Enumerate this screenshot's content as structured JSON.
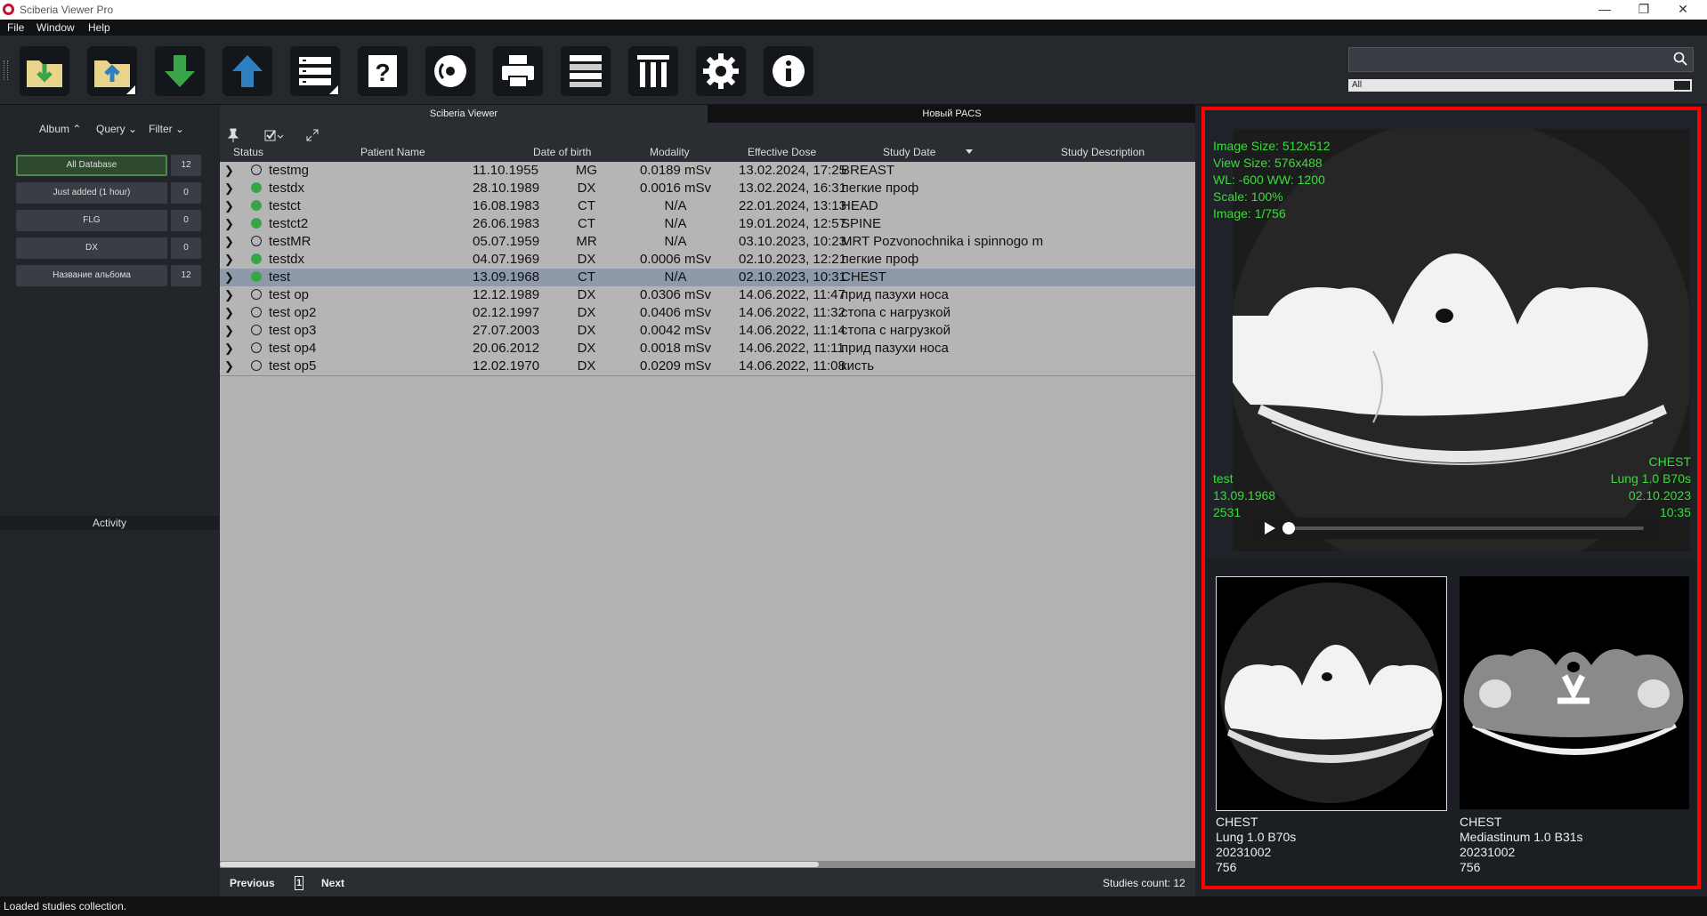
{
  "app": {
    "title": "Sciberia Viewer Pro"
  },
  "window_controls": {
    "minimize": "—",
    "maximize": "❐",
    "close": "✕"
  },
  "menu": [
    "File",
    "Window",
    "Help"
  ],
  "toolbar": {
    "buttons": [
      "import-folder",
      "upload-folder",
      "download",
      "upload",
      "server-list",
      "help",
      "burn-disc",
      "print",
      "layout",
      "delete",
      "settings",
      "info"
    ]
  },
  "search": {
    "placeholder": "",
    "filter_value": "All"
  },
  "left": {
    "album": "Album ⌃",
    "query": "Query ⌄",
    "filter": "Filter ⌄",
    "albums": [
      {
        "label": "All Database",
        "count": "12"
      },
      {
        "label": "Just added (1 hour)",
        "count": "0"
      },
      {
        "label": "FLG",
        "count": "0"
      },
      {
        "label": "DX",
        "count": "0"
      },
      {
        "label": "Название альбома",
        "count": "12"
      }
    ],
    "activity": "Activity"
  },
  "tabs": [
    "Sciberia Viewer",
    "Новый PACS"
  ],
  "table": {
    "headers": {
      "status": "Status",
      "name": "Patient Name",
      "dob": "Date of birth",
      "modality": "Modality",
      "dose": "Effective Dose",
      "date": "Study Date",
      "desc": "Study Description"
    },
    "rows": [
      {
        "status": "empty",
        "name": "testmg",
        "dob": "11.10.1955",
        "modality": "MG",
        "dose": "0.0189 mSv",
        "date": "13.02.2024, 17:25",
        "desc": "BREAST"
      },
      {
        "status": "green",
        "name": "testdx",
        "dob": "28.10.1989",
        "modality": "DX",
        "dose": "0.0016 mSv",
        "date": "13.02.2024, 16:31",
        "desc": "легкие проф"
      },
      {
        "status": "green",
        "name": "testct",
        "dob": "16.08.1983",
        "modality": "CT",
        "dose": "N/A",
        "date": "22.01.2024, 13:13",
        "desc": "HEAD"
      },
      {
        "status": "green",
        "name": "testct2",
        "dob": "26.06.1983",
        "modality": "CT",
        "dose": "N/A",
        "date": "19.01.2024, 12:57",
        "desc": "SPINE"
      },
      {
        "status": "empty",
        "name": "testMR",
        "dob": "05.07.1959",
        "modality": "MR",
        "dose": "N/A",
        "date": "03.10.2023, 10:23",
        "desc": "MRT Pozvonochnika i spinnogo m"
      },
      {
        "status": "green",
        "name": "testdx",
        "dob": "04.07.1969",
        "modality": "DX",
        "dose": "0.0006 mSv",
        "date": "02.10.2023, 12:21",
        "desc": "легкие проф"
      },
      {
        "status": "green",
        "name": "test",
        "dob": "13.09.1968",
        "modality": "CT",
        "dose": "N/A",
        "date": "02.10.2023, 10:31",
        "desc": "CHEST",
        "selected": true
      },
      {
        "status": "empty",
        "name": "test op",
        "dob": "12.12.1989",
        "modality": "DX",
        "dose": "0.0306 mSv",
        "date": "14.06.2022, 11:47",
        "desc": "прид пазухи носа"
      },
      {
        "status": "empty",
        "name": "test op2",
        "dob": "02.12.1997",
        "modality": "DX",
        "dose": "0.0406 mSv",
        "date": "14.06.2022, 11:32",
        "desc": "стопа с нагрузкой"
      },
      {
        "status": "empty",
        "name": "test op3",
        "dob": "27.07.2003",
        "modality": "DX",
        "dose": "0.0042 mSv",
        "date": "14.06.2022, 11:14",
        "desc": "стопа с нагрузкой"
      },
      {
        "status": "empty",
        "name": "test op4",
        "dob": "20.06.2012",
        "modality": "DX",
        "dose": "0.0018 mSv",
        "date": "14.06.2022, 11:11",
        "desc": "прид пазухи носа"
      },
      {
        "status": "empty",
        "name": "test op5",
        "dob": "12.02.1970",
        "modality": "DX",
        "dose": "0.0209 mSv",
        "date": "14.06.2022, 11:08",
        "desc": "кисть"
      }
    ]
  },
  "footer": {
    "previous": "Previous",
    "page": "1",
    "next": "Next",
    "count": "Studies count: 12"
  },
  "status": {
    "message": "Loaded studies collection."
  },
  "viewer": {
    "overlay_tl": [
      "Image Size: 512x512",
      "View Size: 576x488",
      "WL: -600 WW: 1200",
      "Scale: 100%",
      "Image: 1/756"
    ],
    "overlay_bl": [
      "test",
      "13.09.1968",
      "2531"
    ],
    "overlay_br": [
      "CHEST",
      "Lung 1.0  B70s",
      "02.10.2023",
      "10:35"
    ],
    "progress": 0.0
  },
  "series": [
    {
      "lines": [
        "CHEST",
        "Lung 1.0  B70s",
        "20231002",
        "756"
      ],
      "selected": true
    },
    {
      "lines": [
        "CHEST",
        "Mediastinum  1.0  B31s",
        "20231002",
        "756"
      ],
      "selected": false
    }
  ],
  "colors": {
    "accent_red": "#ff0000",
    "overlay_green": "#3bdc3b",
    "status_green": "#3aa548"
  }
}
